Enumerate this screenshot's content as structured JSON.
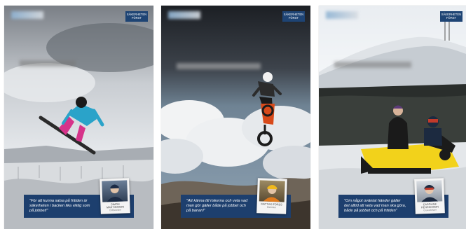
{
  "badge": {
    "line1": "SÄKERHETEN",
    "line2": "FÖRST"
  },
  "posters": [
    {
      "id": "snowboard",
      "quote": "\"För att kunna satsa på fritiden är säkerheten i backen lika viktig som på jobbet!\"",
      "name": "SIMON MARTINSSON",
      "role": "Drifttekniker"
    },
    {
      "id": "motocross",
      "quote": "\"Att känna till riskerna och veta vad man gör gäller både på jobbet och på banan!\"",
      "name": "MATTIAS FORSS",
      "role": "Elektriker"
    },
    {
      "id": "snowmobile",
      "quote": "\"Om något oväntat händer gäller det alltid att veta vad man ska göra, både på jobbet och på fritiden\"",
      "name": "CAROLINE HENRIKSSON",
      "role": "Gruvarbetare"
    }
  ],
  "colors": {
    "brand_blue": "#1e4474",
    "caption_blue": "#1d3f6e",
    "snowmobile_yellow": "#f2d21b"
  }
}
